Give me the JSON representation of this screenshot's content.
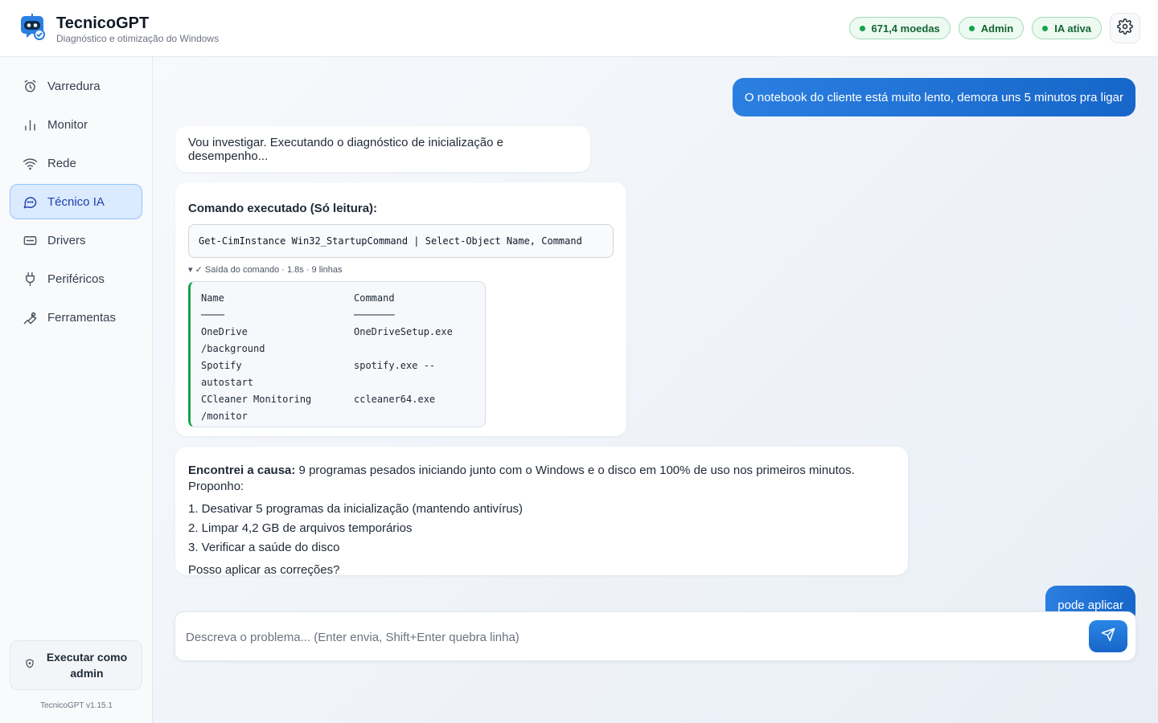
{
  "app": {
    "title": "TecnicoGPT",
    "subtitle": "Diagnóstico e otimização do Windows",
    "logo_icon": "robot-chat-icon"
  },
  "status_badges": [
    {
      "label": "671,4 moedas"
    },
    {
      "label": "Admin"
    },
    {
      "label": "IA ativa"
    }
  ],
  "colors": {
    "accent": "#1e6fd9",
    "success": "#16a34a",
    "active_nav_bg": "#dbeafe"
  },
  "sidebar": {
    "items": [
      {
        "label": "Varredura",
        "icon": "alarm-clock-icon",
        "active": false
      },
      {
        "label": "Monitor",
        "icon": "bar-chart-icon",
        "active": false
      },
      {
        "label": "Rede",
        "icon": "wifi-icon",
        "active": false
      },
      {
        "label": "Técnico IA",
        "icon": "chat-bubble-icon",
        "active": true
      },
      {
        "label": "Drivers",
        "icon": "hard-drive-icon",
        "active": false
      },
      {
        "label": "Periféricos",
        "icon": "plug-icon",
        "active": false
      },
      {
        "label": "Ferramentas",
        "icon": "wrench-icon",
        "active": false
      }
    ],
    "admin_button": "Executar como admin",
    "version": "TecnicoGPT v1.15.1"
  },
  "chat": {
    "messages": [
      {
        "role": "user",
        "text": "O notebook do cliente está muito lento, demora uns 5 minutos pra ligar"
      },
      {
        "role": "assistant",
        "text": "Vou investigar. Executando o diagnóstico de inicialização e desempenho..."
      },
      {
        "role": "assistant",
        "command_title": "Comando executado (Só leitura):",
        "command": "Get-CimInstance Win32_StartupCommand | Select-Object Name, Command",
        "output_meta": "▾ ✓ Saída do comando · 1.8s · 9 linhas",
        "output": {
          "headers": [
            "Name",
            "Command"
          ],
          "underlines": [
            "────",
            "───────"
          ],
          "rows": [
            [
              "OneDrive",
              "OneDriveSetup.exe"
            ],
            [
              "/background",
              ""
            ],
            [
              "Spotify",
              "spotify.exe --"
            ],
            [
              "autostart",
              ""
            ],
            [
              "CCleaner Monitoring",
              "ccleaner64.exe"
            ],
            [
              "/monitor",
              ""
            ]
          ]
        }
      },
      {
        "role": "assistant",
        "lead_bold": "Encontrei a causa:",
        "lead_text": " 9 programas pesados iniciando junto com o Windows e o disco em 100% de uso nos primeiros minutos. Proponho:",
        "steps": [
          "1. Desativar 5 programas da inicialização (mantendo antivírus)",
          "2. Limpar 4,2 GB de arquivos temporários",
          "3. Verificar a saúde do disco"
        ],
        "question": "Posso aplicar as correções?"
      },
      {
        "role": "user",
        "text": "pode aplicar"
      }
    ]
  },
  "composer": {
    "placeholder": "Descreva o problema... (Enter envia, Shift+Enter quebra linha)",
    "value": "",
    "send_icon": "paper-plane-icon"
  }
}
